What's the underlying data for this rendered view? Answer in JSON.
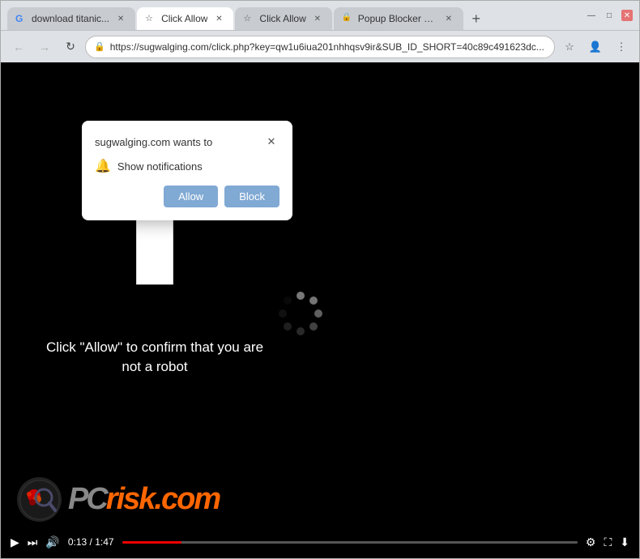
{
  "browser": {
    "tabs": [
      {
        "id": "tab1",
        "favicon": "G",
        "title": "download titanic...",
        "active": false,
        "closable": true
      },
      {
        "id": "tab2",
        "favicon": "☆",
        "title": "Click Allow",
        "active": true,
        "closable": true
      },
      {
        "id": "tab3",
        "favicon": "☆",
        "title": "Click Allow",
        "active": false,
        "closable": true
      },
      {
        "id": "tab4",
        "favicon": "🔒",
        "title": "Popup Blocker C...",
        "active": false,
        "closable": true
      }
    ],
    "address_bar": {
      "url": "https://sugwalging.com/click.php?key=qw1u6iua201nhhqsv9ir&SUB_ID_SHORT=40c89c491623dc...",
      "icon": "🔒"
    },
    "window_controls": {
      "minimize": "—",
      "maximize": "□",
      "close": "✕"
    }
  },
  "popup": {
    "title": "sugwalging.com wants to",
    "notification_text": "Show notifications",
    "allow_button": "Allow",
    "block_button": "Block",
    "close_icon": "✕"
  },
  "page": {
    "instruction_text": "Click \"Allow\" to confirm that you are not a robot",
    "pcrisk_text": "risk.com",
    "pcrisk_prefix": "PC"
  },
  "video_controls": {
    "play_icon": "▶",
    "next_icon": "⏭",
    "volume_icon": "🔊",
    "time_current": "0:13",
    "time_total": "1:47",
    "settings_icon": "⚙",
    "fullscreen_icon": "⛶",
    "download_icon": "⬇"
  },
  "colors": {
    "accent": "#ff6600",
    "tab_active_bg": "#ffffff",
    "tab_inactive_bg": "#c8cbd0",
    "browser_chrome": "#dee1e6",
    "page_bg": "#000000",
    "popup_bg": "#ffffff",
    "allow_btn": "#80a9d4",
    "block_btn": "#80a9d4"
  }
}
